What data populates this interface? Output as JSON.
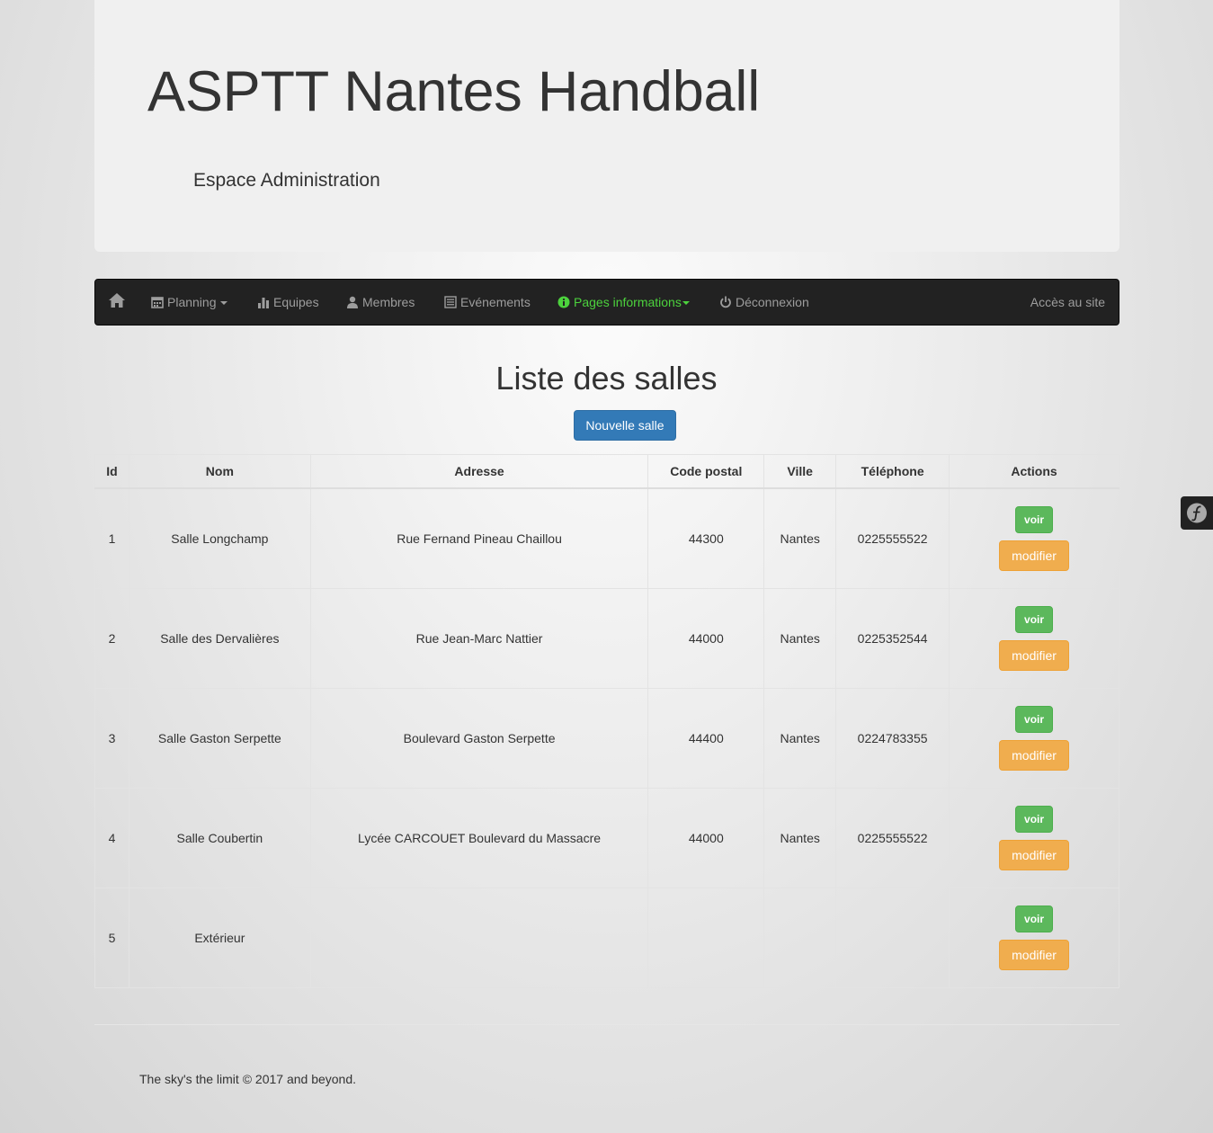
{
  "header": {
    "title": "ASPTT Nantes Handball",
    "subtitle": "Espace Administration"
  },
  "navbar": {
    "home_icon": "home-icon",
    "items": [
      {
        "label": "Planning",
        "icon": "calendar-icon",
        "dropdown": true
      },
      {
        "label": "Equipes",
        "icon": "stats-icon"
      },
      {
        "label": "Membres",
        "icon": "user-icon"
      },
      {
        "label": "Evénements",
        "icon": "list-icon"
      },
      {
        "label": "Pages informations",
        "icon": "info-icon",
        "dropdown": true,
        "active": true
      },
      {
        "label": "Déconnexion",
        "icon": "power-icon"
      }
    ],
    "right_link": "Accès au site",
    "active_color": "#4cd23d"
  },
  "main": {
    "title": "Liste des salles",
    "new_button": "Nouvelle salle",
    "table": {
      "headers": [
        "Id",
        "Nom",
        "Adresse",
        "Code postal",
        "Ville",
        "Téléphone",
        "Actions"
      ],
      "rows": [
        {
          "id": "1",
          "nom": "Salle Longchamp",
          "adresse": "Rue Fernand Pineau Chaillou",
          "code_postal": "44300",
          "ville": "Nantes",
          "telephone": "0225555522"
        },
        {
          "id": "2",
          "nom": "Salle des Dervalières",
          "adresse": "Rue Jean-Marc Nattier",
          "code_postal": "44000",
          "ville": "Nantes",
          "telephone": "0225352544"
        },
        {
          "id": "3",
          "nom": "Salle Gaston Serpette",
          "adresse": "Boulevard Gaston Serpette",
          "code_postal": "44400",
          "ville": "Nantes",
          "telephone": "0224783355"
        },
        {
          "id": "4",
          "nom": "Salle Coubertin",
          "adresse": "Lycée CARCOUET Boulevard du Massacre",
          "code_postal": "44000",
          "ville": "Nantes",
          "telephone": "0225555522"
        },
        {
          "id": "5",
          "nom": "Extérieur",
          "adresse": "",
          "code_postal": "",
          "ville": "",
          "telephone": ""
        }
      ],
      "actions": {
        "view": "voir",
        "edit": "modifier"
      }
    }
  },
  "footer": {
    "text": "The sky's the limit © 2017 and beyond."
  },
  "symfony_toolbar": {
    "icon": "symfony-icon"
  },
  "colors": {
    "primary": "#337ab7",
    "success": "#5cb85c",
    "warning": "#f0ad4e",
    "navbar": "#222222"
  }
}
